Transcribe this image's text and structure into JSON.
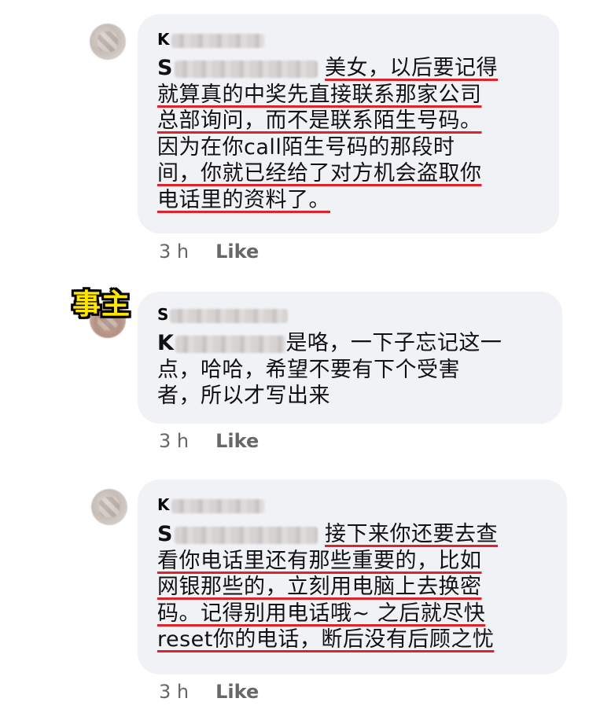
{
  "comments": [
    {
      "author_initial": "K",
      "mention_initial": "S",
      "lines": [
        "美女，以后要记得",
        "就算真的中奖先直接联系那家公司",
        "总部询问，而不是联系陌生号码。",
        "因为在你call陌生号码的那段时",
        "间，你就已经给了对方机会盗取你",
        "电话里的资料了。"
      ],
      "time": "3 h",
      "like_label": "Like"
    },
    {
      "badge": "事主",
      "author_initial": "S",
      "mention_initial": "K",
      "lines": [
        "是咯，一下子忘记这一",
        "点，哈哈，希望不要有下个受害",
        "者，所以才写出来"
      ],
      "time": "3 h",
      "like_label": "Like"
    },
    {
      "author_initial": "K",
      "mention_initial": "S",
      "lines": [
        "接下来你还要去查",
        "看你电话里还有那些重要的，比如",
        "网银那些的，立刻用电脑上去换密",
        "码。记得别用电话哦~ 之后就尽快",
        "reset你的电话，断后没有后顾之忧"
      ],
      "time": "3 h",
      "like_label": "Like"
    }
  ]
}
